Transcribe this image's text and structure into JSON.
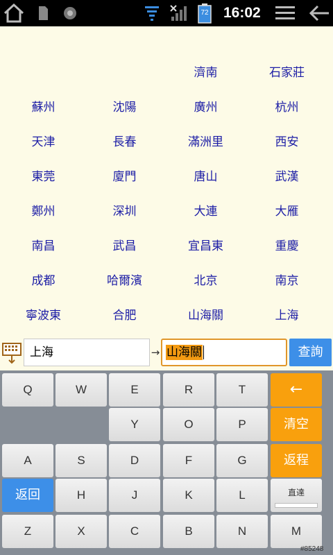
{
  "status_bar": {
    "time": "16:02",
    "battery_level": "72",
    "icons": [
      "home-icon",
      "sd-card-icon",
      "android-icon",
      "download-icon",
      "signal-icon",
      "battery-icon",
      "menu-icon",
      "back-icon"
    ]
  },
  "stations": [
    {
      "row": 0,
      "col": 2,
      "name": "濟南"
    },
    {
      "row": 0,
      "col": 3,
      "name": "石家莊"
    },
    {
      "row": 1,
      "col": 0,
      "name": "蘇州"
    },
    {
      "row": 1,
      "col": 1,
      "name": "沈陽"
    },
    {
      "row": 1,
      "col": 2,
      "name": "廣州"
    },
    {
      "row": 1,
      "col": 3,
      "name": "杭州"
    },
    {
      "row": 2,
      "col": 0,
      "name": "天津"
    },
    {
      "row": 2,
      "col": 1,
      "name": "長春"
    },
    {
      "row": 2,
      "col": 2,
      "name": "滿洲里"
    },
    {
      "row": 2,
      "col": 3,
      "name": "西安"
    },
    {
      "row": 3,
      "col": 0,
      "name": "東莞"
    },
    {
      "row": 3,
      "col": 1,
      "name": "廈門"
    },
    {
      "row": 3,
      "col": 2,
      "name": "唐山"
    },
    {
      "row": 3,
      "col": 3,
      "name": "武漢"
    },
    {
      "row": 4,
      "col": 0,
      "name": "鄭州"
    },
    {
      "row": 4,
      "col": 1,
      "name": "深圳"
    },
    {
      "row": 4,
      "col": 2,
      "name": "大連"
    },
    {
      "row": 4,
      "col": 3,
      "name": "大雁"
    },
    {
      "row": 5,
      "col": 0,
      "name": "南昌"
    },
    {
      "row": 5,
      "col": 1,
      "name": "武昌"
    },
    {
      "row": 5,
      "col": 2,
      "name": "宜昌東"
    },
    {
      "row": 5,
      "col": 3,
      "name": "重慶"
    },
    {
      "row": 6,
      "col": 0,
      "name": "成都"
    },
    {
      "row": 6,
      "col": 1,
      "name": "哈爾濱"
    },
    {
      "row": 6,
      "col": 2,
      "name": "北京"
    },
    {
      "row": 6,
      "col": 3,
      "name": "南京"
    },
    {
      "row": 7,
      "col": 0,
      "name": "寧波東"
    },
    {
      "row": 7,
      "col": 1,
      "name": "合肥"
    },
    {
      "row": 7,
      "col": 2,
      "name": "山海關"
    },
    {
      "row": 7,
      "col": 3,
      "name": "上海"
    }
  ],
  "search": {
    "from_value": "上海",
    "arrow": "→",
    "to_value": "山海關",
    "query_label": "查詢"
  },
  "keyboard": {
    "rows": [
      [
        {
          "label": "Q"
        },
        {
          "label": "W"
        },
        {
          "label": "E"
        },
        {
          "label": "R"
        },
        {
          "label": "T"
        },
        {
          "label": "←",
          "type": "orange",
          "name": "backspace-key"
        }
      ],
      [
        {
          "label": "",
          "type": "empty"
        },
        {
          "label": "Y"
        },
        {
          "label": "O"
        },
        {
          "label": "P"
        },
        {
          "label": "清空",
          "type": "orange",
          "name": "clear-key"
        }
      ],
      [
        {
          "label": "A"
        },
        {
          "label": "S"
        },
        {
          "label": "D"
        },
        {
          "label": "F"
        },
        {
          "label": "G"
        },
        {
          "label": "返程",
          "type": "orange",
          "name": "return-trip-key"
        }
      ],
      [
        {
          "label": "返回",
          "type": "blue",
          "name": "back-key"
        },
        {
          "label": "H"
        },
        {
          "label": "J"
        },
        {
          "label": "K"
        },
        {
          "label": "L"
        },
        {
          "label": "直達",
          "type": "small",
          "name": "direct-key"
        }
      ],
      [
        {
          "label": "Z"
        },
        {
          "label": "X"
        },
        {
          "label": "C"
        },
        {
          "label": "B"
        },
        {
          "label": "N"
        },
        {
          "label": "M"
        }
      ]
    ]
  },
  "watermark": "#85248",
  "colors": {
    "background": "#fdfbe7",
    "station_text": "#1d1ea6",
    "accent_orange": "#f9a00d",
    "accent_blue": "#3d8fe8"
  }
}
